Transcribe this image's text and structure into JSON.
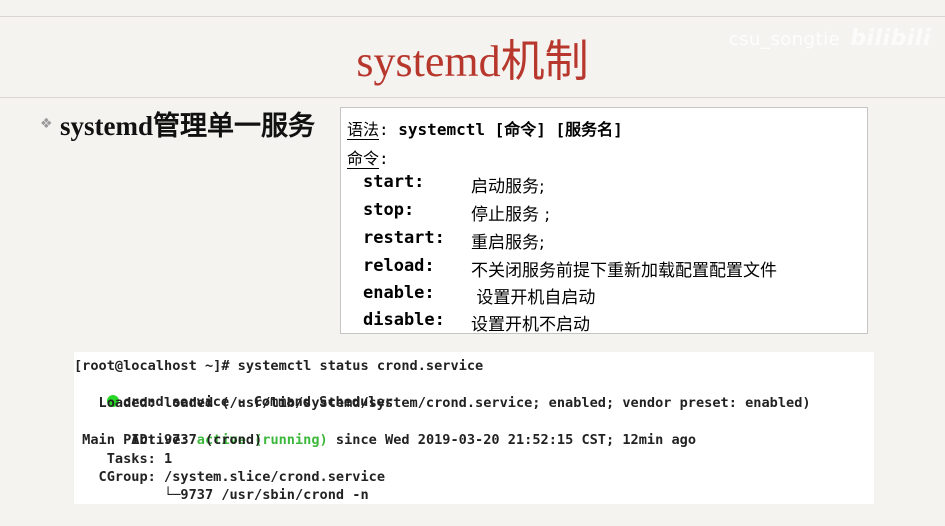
{
  "slide": {
    "title": "systemd机制",
    "watermark": "csu_songtie",
    "watermark_logo": "bilibili",
    "bullet": "systemd管理单一服务"
  },
  "syntax": {
    "label": "语法",
    "colon": ": ",
    "command": "systemctl [命令] [服务名]",
    "commands_label": "命令",
    "commands_colon": ":",
    "commands": [
      {
        "name": "start:",
        "desc": "启动服务;"
      },
      {
        "name": "stop:",
        "desc": "停止服务 ;"
      },
      {
        "name": "restart:",
        "desc": "重启服务;"
      },
      {
        "name": "reload:",
        "desc": "不关闭服务前提下重新加载配置配置文件"
      },
      {
        "name": "enable:",
        "desc": " 设置开机自启动"
      },
      {
        "name": "disable:",
        "desc": "设置开机不启动"
      }
    ]
  },
  "terminal": {
    "prompt": "[root@localhost ~]# systemctl status crond.service",
    "service_line": "crond.service - Command Scheduler",
    "loaded": "   Loaded: loaded (/usr/lib/systemd/system/crond.service; enabled; vendor preset: enabled)",
    "active_prefix": "   Active: ",
    "active_status": "active (running)",
    "active_suffix": " since Wed 2019-03-20 21:52:15 CST; 12min ago",
    "main_pid": " Main PID: 9737 (crond)",
    "tasks": "    Tasks: 1",
    "cgroup": "   CGroup: /system.slice/crond.service",
    "cgroup_child": "           └─9737 /usr/sbin/crond -n"
  },
  "colors": {
    "title": "#b8372d",
    "active_green": "#3db83d",
    "status_dot": "#28d628",
    "background": "#f4f3f0"
  }
}
